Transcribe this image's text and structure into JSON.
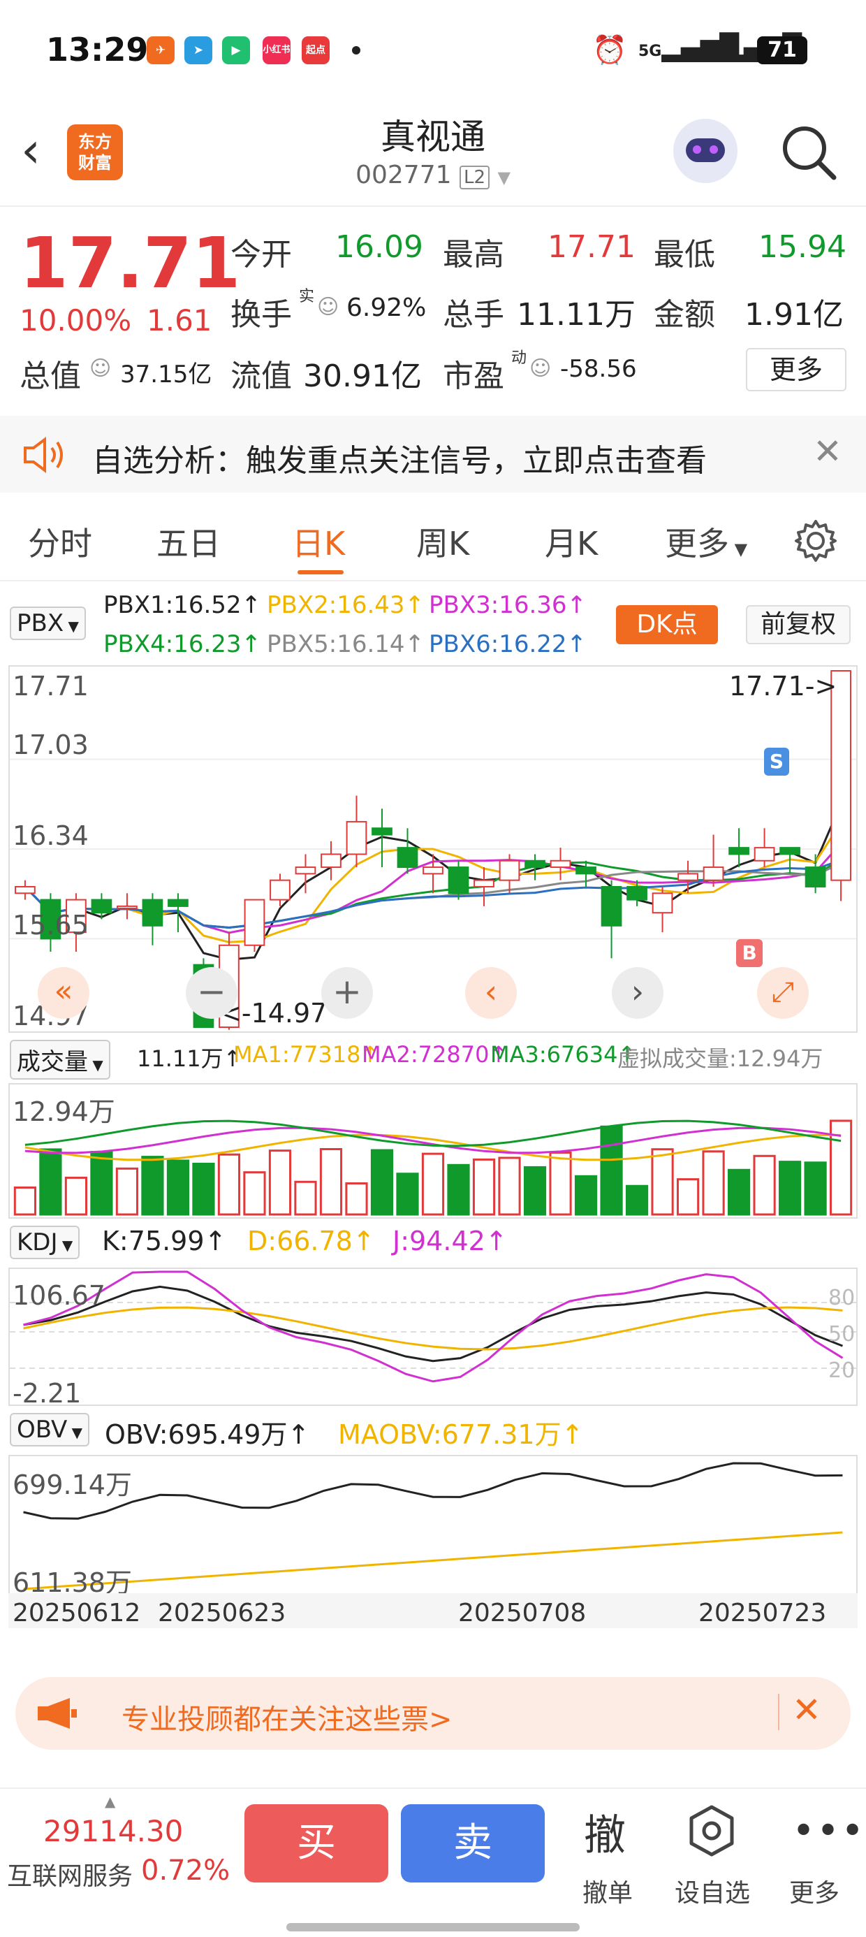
{
  "status": {
    "time": "13:29",
    "battery": "71",
    "net1": "5G",
    "net2": "5G"
  },
  "header": {
    "title": "真视通",
    "code": "002771",
    "level": "L2",
    "logo": "东方\n财富"
  },
  "quote": {
    "price": "17.71",
    "pct": "10.00%",
    "change": "1.61",
    "open_label": "今开",
    "open": "16.09",
    "high_label": "最高",
    "high": "17.71",
    "low_label": "最低",
    "low": "15.94",
    "turnover_label": "换手",
    "turnover": "6.92%",
    "vol_label": "总手",
    "vol": "11.11万",
    "amount_label": "金额",
    "amount": "1.91亿",
    "mcap_label": "总值",
    "mcap": "37.15亿",
    "float_label": "流值",
    "float": "30.91亿",
    "pe_label": "市盈",
    "pe": "-58.56",
    "more": "更多",
    "shi": "实",
    "dong": "动"
  },
  "alert": {
    "text": "自选分析：触发重点关注信号，立即点击查看"
  },
  "tabs": [
    "分时",
    "五日",
    "日K",
    "周K",
    "月K",
    "更多"
  ],
  "kline": {
    "selector": "PBX",
    "pbx1": "PBX1:16.52↑",
    "pbx2": "PBX2:16.43↑",
    "pbx3": "PBX3:16.36↑",
    "pbx4": "PBX4:16.23↑",
    "pbx5": "PBX5:16.14↑",
    "pbx6": "PBX6:16.22↑",
    "dk": "DK点",
    "fq": "前复权",
    "y_labels": [
      "17.71",
      "17.03",
      "16.34",
      "15.65",
      "14.97"
    ],
    "max_tag": "17.71->",
    "min_tag": "<-14.97",
    "s_mark": "S",
    "b_mark": "B"
  },
  "volume": {
    "selector": "成交量",
    "vol": "11.11万↑",
    "ma1": "MA1:77318↑",
    "ma2": "MA2:72870↑",
    "ma3": "MA3:67634↑",
    "virtual": "虚拟成交量:12.94万",
    "ymax": "12.94万"
  },
  "kdj": {
    "selector": "KDJ",
    "k": "K:75.99↑",
    "d": "D:66.78↑",
    "j": "J:94.42↑",
    "ymax": "106.67",
    "ymin": "-2.21",
    "l80": "80",
    "l50": "50",
    "l20": "20"
  },
  "obv": {
    "selector": "OBV",
    "obv": "OBV:695.49万↑",
    "maobv": "MAOBV:677.31万↑",
    "ymax": "699.14万",
    "ymin": "611.38万"
  },
  "dates": [
    "20250612",
    "20250623",
    "20250708",
    "20250723"
  ],
  "banner": {
    "text": "专业投顾都在关注这些票>"
  },
  "bottom": {
    "index_value": "29114.30",
    "index_name": "互联网服务",
    "index_pct": "0.72%",
    "buy": "买",
    "sell": "卖",
    "cancel_big": "撤",
    "cancel": "撤单",
    "watch": "设自选",
    "more": "更多"
  },
  "chart_data": {
    "type": "candlestick",
    "ylim": [
      14.97,
      17.71
    ],
    "candles": [
      {
        "o": 16.0,
        "c": 16.05,
        "h": 16.1,
        "l": 15.95
      },
      {
        "o": 15.95,
        "c": 15.65,
        "h": 16.0,
        "l": 15.55
      },
      {
        "o": 15.7,
        "c": 15.95,
        "h": 16.0,
        "l": 15.55
      },
      {
        "o": 15.95,
        "c": 15.85,
        "h": 16.0,
        "l": 15.8
      },
      {
        "o": 15.9,
        "c": 15.9,
        "h": 16.0,
        "l": 15.8
      },
      {
        "o": 15.95,
        "c": 15.75,
        "h": 16.0,
        "l": 15.6
      },
      {
        "o": 15.95,
        "c": 15.9,
        "h": 16.0,
        "l": 15.7
      },
      {
        "o": 15.45,
        "c": 14.97,
        "h": 15.5,
        "l": 14.97
      },
      {
        "o": 14.97,
        "c": 15.6,
        "h": 15.7,
        "l": 14.95
      },
      {
        "o": 15.6,
        "c": 15.95,
        "h": 15.95,
        "l": 15.55
      },
      {
        "o": 15.95,
        "c": 16.1,
        "h": 16.15,
        "l": 15.9
      },
      {
        "o": 16.15,
        "c": 16.2,
        "h": 16.3,
        "l": 16.0
      },
      {
        "o": 16.2,
        "c": 16.3,
        "h": 16.4,
        "l": 16.1
      },
      {
        "o": 16.3,
        "c": 16.55,
        "h": 16.75,
        "l": 16.2
      },
      {
        "o": 16.5,
        "c": 16.45,
        "h": 16.65,
        "l": 16.2
      },
      {
        "o": 16.35,
        "c": 16.2,
        "h": 16.5,
        "l": 16.15
      },
      {
        "o": 16.15,
        "c": 16.2,
        "h": 16.3,
        "l": 16.0
      },
      {
        "o": 16.2,
        "c": 16.0,
        "h": 16.25,
        "l": 15.95
      },
      {
        "o": 16.05,
        "c": 16.1,
        "h": 16.2,
        "l": 15.9
      },
      {
        "o": 16.1,
        "c": 16.25,
        "h": 16.3,
        "l": 16.0
      },
      {
        "o": 16.25,
        "c": 16.2,
        "h": 16.3,
        "l": 16.1
      },
      {
        "o": 16.2,
        "c": 16.25,
        "h": 16.35,
        "l": 16.1
      },
      {
        "o": 16.2,
        "c": 16.15,
        "h": 16.25,
        "l": 16.05
      },
      {
        "o": 16.05,
        "c": 15.75,
        "h": 16.1,
        "l": 15.5
      },
      {
        "o": 16.05,
        "c": 15.95,
        "h": 16.1,
        "l": 15.9
      },
      {
        "o": 15.85,
        "c": 16.0,
        "h": 16.05,
        "l": 15.7
      },
      {
        "o": 16.1,
        "c": 16.15,
        "h": 16.25,
        "l": 16.0
      },
      {
        "o": 16.1,
        "c": 16.2,
        "h": 16.45,
        "l": 16.05
      },
      {
        "o": 16.35,
        "c": 16.3,
        "h": 16.5,
        "l": 16.2
      },
      {
        "o": 16.25,
        "c": 16.35,
        "h": 16.5,
        "l": 16.2
      },
      {
        "o": 16.35,
        "c": 16.3,
        "h": 16.35,
        "l": 16.15
      },
      {
        "o": 16.2,
        "c": 16.05,
        "h": 16.3,
        "l": 16.0
      },
      {
        "o": 16.1,
        "c": 17.71,
        "h": 17.71,
        "l": 15.94
      }
    ]
  }
}
